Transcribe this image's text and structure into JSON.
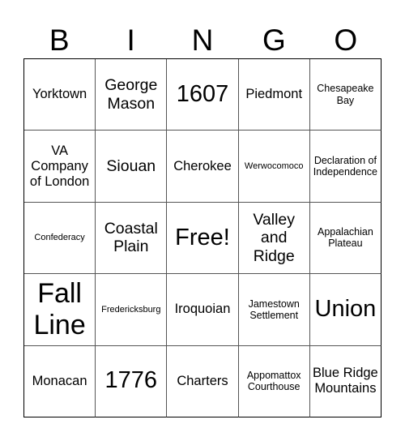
{
  "header": {
    "letters": [
      "B",
      "I",
      "N",
      "G",
      "O"
    ]
  },
  "card": {
    "cells": [
      {
        "text": "Yorktown",
        "size": "s-md"
      },
      {
        "text": "George Mason",
        "size": "s-lg"
      },
      {
        "text": "1607",
        "size": "s-xl"
      },
      {
        "text": "Piedmont",
        "size": "s-md"
      },
      {
        "text": "Chesapeake Bay",
        "size": "s-sm"
      },
      {
        "text": "VA Company of London",
        "size": "s-md"
      },
      {
        "text": "Siouan",
        "size": "s-lg"
      },
      {
        "text": "Cherokee",
        "size": "s-md"
      },
      {
        "text": "Werwocomoco",
        "size": "s-xs"
      },
      {
        "text": "Declaration of Independence",
        "size": "s-sm"
      },
      {
        "text": "Confederacy",
        "size": "s-xs"
      },
      {
        "text": "Coastal Plain",
        "size": "s-lg"
      },
      {
        "text": "Free!",
        "size": "s-xl"
      },
      {
        "text": "Valley and Ridge",
        "size": "s-lg"
      },
      {
        "text": "Appalachian Plateau",
        "size": "s-sm"
      },
      {
        "text": "Fall Line",
        "size": "s-xxl"
      },
      {
        "text": "Fredericksburg",
        "size": "s-xs"
      },
      {
        "text": "Iroquoian",
        "size": "s-md"
      },
      {
        "text": "Jamestown Settlement",
        "size": "s-sm"
      },
      {
        "text": "Union",
        "size": "s-xl"
      },
      {
        "text": "Monacan",
        "size": "s-md"
      },
      {
        "text": "1776",
        "size": "s-xl"
      },
      {
        "text": "Charters",
        "size": "s-md"
      },
      {
        "text": "Appomattox Courthouse",
        "size": "s-sm"
      },
      {
        "text": "Blue Ridge Mountains",
        "size": "s-md"
      }
    ]
  }
}
